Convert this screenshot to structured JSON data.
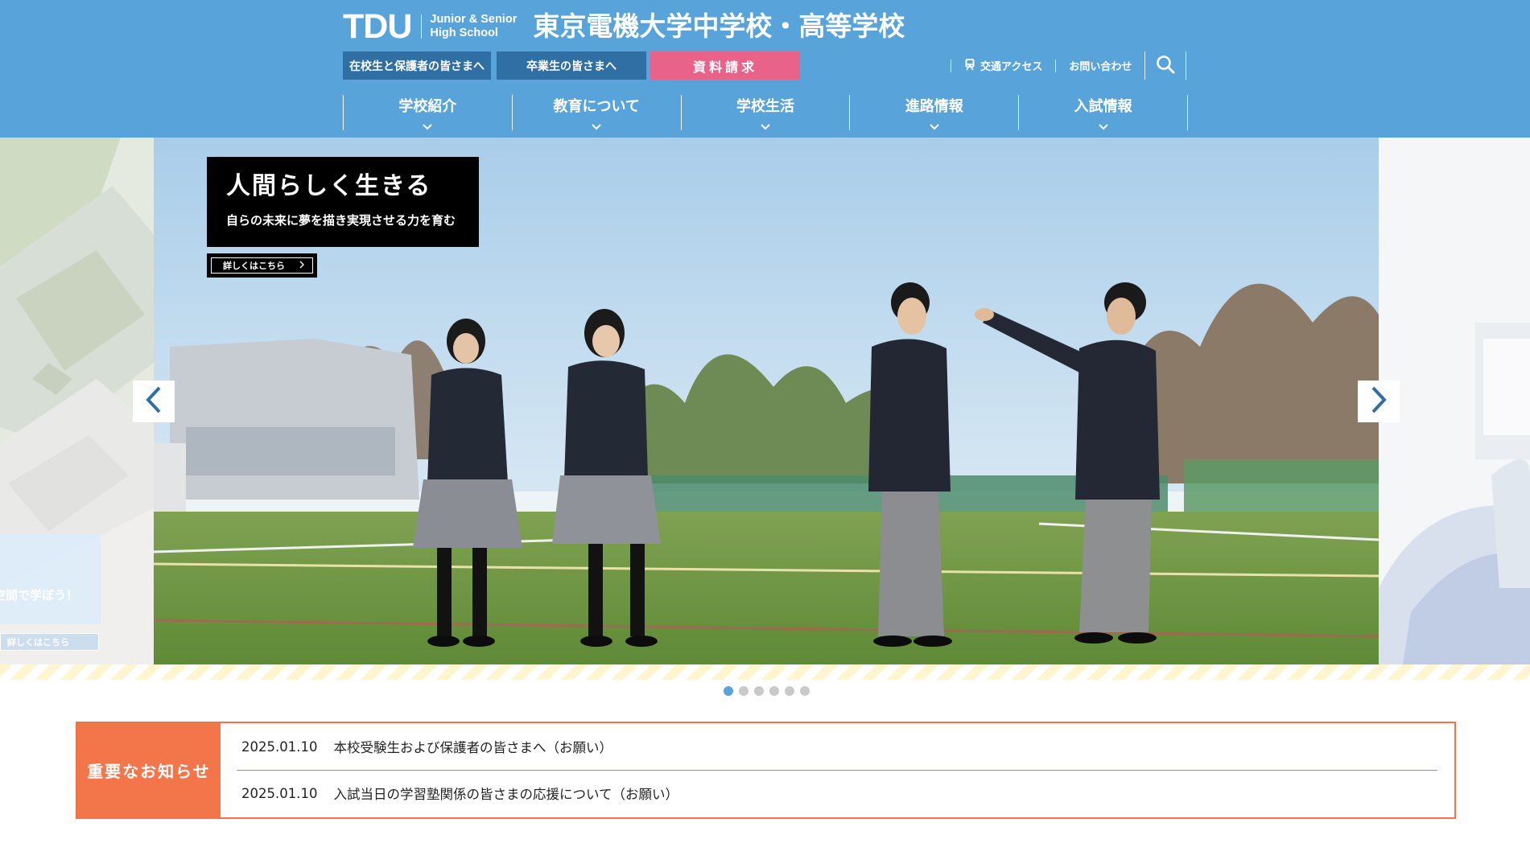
{
  "header": {
    "logo_mark": "TDU",
    "logo_sub_line1": "Junior & Senior",
    "logo_sub_line2": "High School",
    "school_name": "東京電機大学中学校・高等学校",
    "buttons": {
      "current_students": "在校生と保護者の皆さまへ",
      "alumni": "卒業生の皆さまへ",
      "request_materials": "資料請求"
    },
    "utility": {
      "access": "交通アクセス",
      "contact": "お問い合わせ"
    },
    "gnav": [
      {
        "label": "学校紹介"
      },
      {
        "label": "教育について"
      },
      {
        "label": "学校生活"
      },
      {
        "label": "進路情報"
      },
      {
        "label": "入試情報"
      }
    ],
    "colors": {
      "header_bg": "#58a3d9",
      "button_bg": "#2f6fa3",
      "request_bg": "#e8628a"
    }
  },
  "slider": {
    "left_peek": {
      "caption": "空間で学ぼう！",
      "button": "詳しくはこちら"
    },
    "main": {
      "title": "人間らしく生きる",
      "subtitle": "自らの未来に夢を描き実現させる力を育む",
      "button": "詳しくはこちら"
    },
    "prev_icon": "chevron-left-icon",
    "next_icon": "chevron-right-icon",
    "dots_count": 6,
    "active_dot": 1
  },
  "notice": {
    "label": "重要なお知らせ",
    "items": [
      {
        "date": "2025.01.10",
        "title": "本校受験生および保護者の皆さまへ（お願い）"
      },
      {
        "date": "2025.01.10",
        "title": "入試当日の学習塾関係の皆さまの応援について（お願い）"
      }
    ],
    "accent": "#f3754a"
  }
}
